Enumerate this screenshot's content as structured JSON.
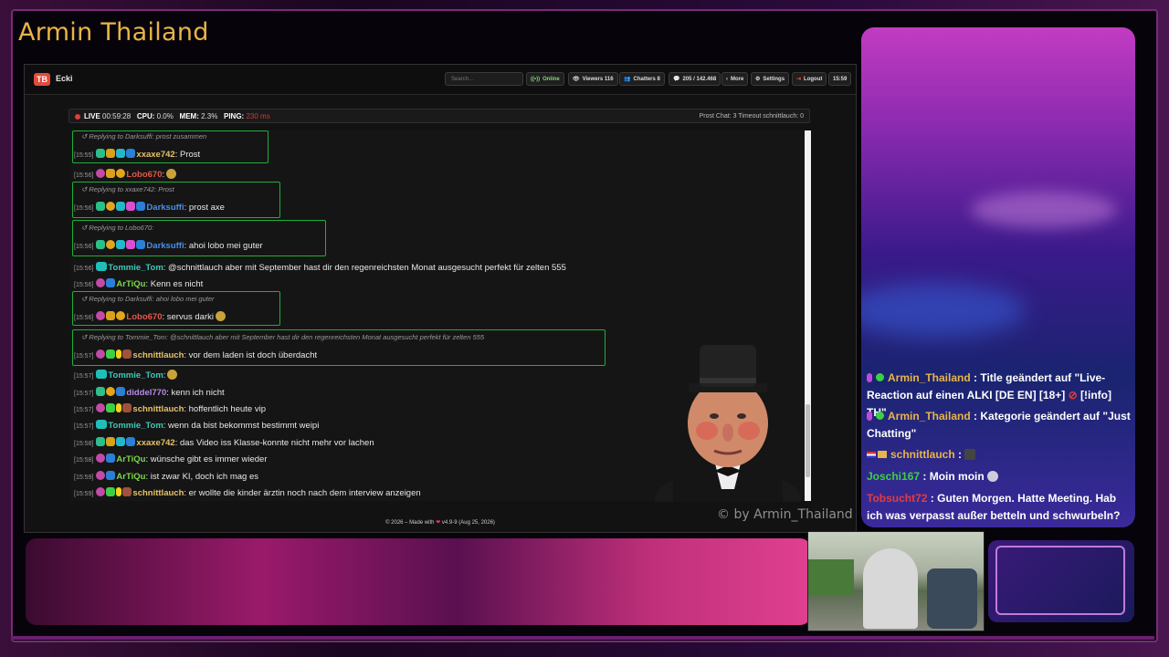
{
  "stream": {
    "title": "Armin Thailand",
    "watermark": "© by Armin_Thailand"
  },
  "app": {
    "logo_text": "TB",
    "channel": "Ecki",
    "search_placeholder": "Search...",
    "buttons": {
      "online": "Online",
      "viewers": "Viewers 116",
      "chatters": "Chatters 8",
      "messages": "205 / 142.468",
      "more": "More",
      "settings": "Settings",
      "logout": "Logout",
      "clock": "15:59"
    }
  },
  "status": {
    "live": "LIVE",
    "uptime": "00:59:28",
    "cpu_label": "CPU:",
    "cpu": "0.0%",
    "mem_label": "MEM:",
    "mem": "2.3%",
    "ping_label": "PING:",
    "ping": "230 ms",
    "right": "Prost Chat: 3  Timeout schnittlauch: 0"
  },
  "chat": {
    "messages": [
      {
        "reply": "Replying to Darksuffi: prost zusammen",
        "ts": "[15:55]",
        "user": "xxaxe742",
        "color": "#e8c26a",
        "text": ": Prost"
      },
      {
        "ts": "[15:56]",
        "user": "Lobo670",
        "color": "#e05a4a",
        "text": ":"
      },
      {
        "reply": "Replying to xxaxe742: Prost",
        "ts": "[15:56]",
        "user": "Darksuffi",
        "color": "#4a8ee8",
        "text": ": prost axe"
      },
      {
        "reply": "Replying to Lobo670:",
        "ts": "[15:56]",
        "user": "Darksuffi",
        "color": "#4a8ee8",
        "text": ": ahoi lobo mei guter"
      },
      {
        "ts": "[15:56]",
        "user": "Tommie_Tom",
        "color": "#3bc9b6",
        "text": ": @schnittlauch aber mit September hast dir den regenreichsten Monat ausgesucht perfekt für zelten 555"
      },
      {
        "ts": "[15:56]",
        "user": "ArTiQu",
        "color": "#7ad94a",
        "text": ": Kenn es nicht"
      },
      {
        "reply": "Replying to Darksuffi: ahoi lobo mei guter",
        "ts": "[15:56]",
        "user": "Lobo670",
        "color": "#e05a4a",
        "text": ": servus darki"
      },
      {
        "reply": "Replying to Tommie_Tom: @schnittlauch aber mit September hast dir den regenreichsten Monat ausgesucht perfekt für zelten 555",
        "ts": "[15:57]",
        "user": "schnittlauch",
        "color": "#e8c26a",
        "text": ": vor dem laden ist doch überdacht"
      },
      {
        "ts": "[15:57]",
        "user": "Tommie_Tom",
        "color": "#3bc9b6",
        "text": ":"
      },
      {
        "ts": "[15:57]",
        "user": "diddel770",
        "color": "#b88ae8",
        "text": ": kenn ich nicht"
      },
      {
        "ts": "[15:57]",
        "user": "schnittlauch",
        "color": "#e8c26a",
        "text": ": hoffentlich heute vip"
      },
      {
        "ts": "[15:57]",
        "user": "Tommie_Tom",
        "color": "#3bc9b6",
        "text": ": wenn da bist bekommst bestimmt weipi"
      },
      {
        "ts": "[15:58]",
        "user": "xxaxe742",
        "color": "#e8c26a",
        "text": ": das Video iss Klasse-konnte nicht mehr vor lachen"
      },
      {
        "ts": "[15:58]",
        "user": "ArTiQu",
        "color": "#7ad94a",
        "text": ": wünsche gibt es immer wieder"
      },
      {
        "ts": "[15:59]",
        "user": "ArTiQu",
        "color": "#7ad94a",
        "text": ": ist zwar KI, doch ich mag es"
      },
      {
        "ts": "[15:59]",
        "user": "schnittlauch",
        "color": "#e8c26a",
        "text": ": er wollte die kinder ärztin noch nach dem interview anzeigen"
      }
    ]
  },
  "footer": {
    "text": "© 2026 – Made with",
    "version": "v4.9-9 (Aug 25, 2026)"
  },
  "side_chat": [
    {
      "user": "Armin_Thailand",
      "text": " : Title geändert auf \"Live-Reaction auf einen ALKI [DE EN] [18+]",
      "text2": " [!info] TH\""
    },
    {
      "user": "Armin_Thailand",
      "text": " : Kategorie geändert auf \"Just Chatting\""
    },
    {
      "user": "schnittlauch",
      "text": " :"
    },
    {
      "user": "Joschi167",
      "text": " : Moin moin"
    },
    {
      "user": "Tobsucht72",
      "text": " : Guten Morgen. Hatte Meeting. Hab ich was verpasst außer betteln und schwurbeln?"
    }
  ]
}
